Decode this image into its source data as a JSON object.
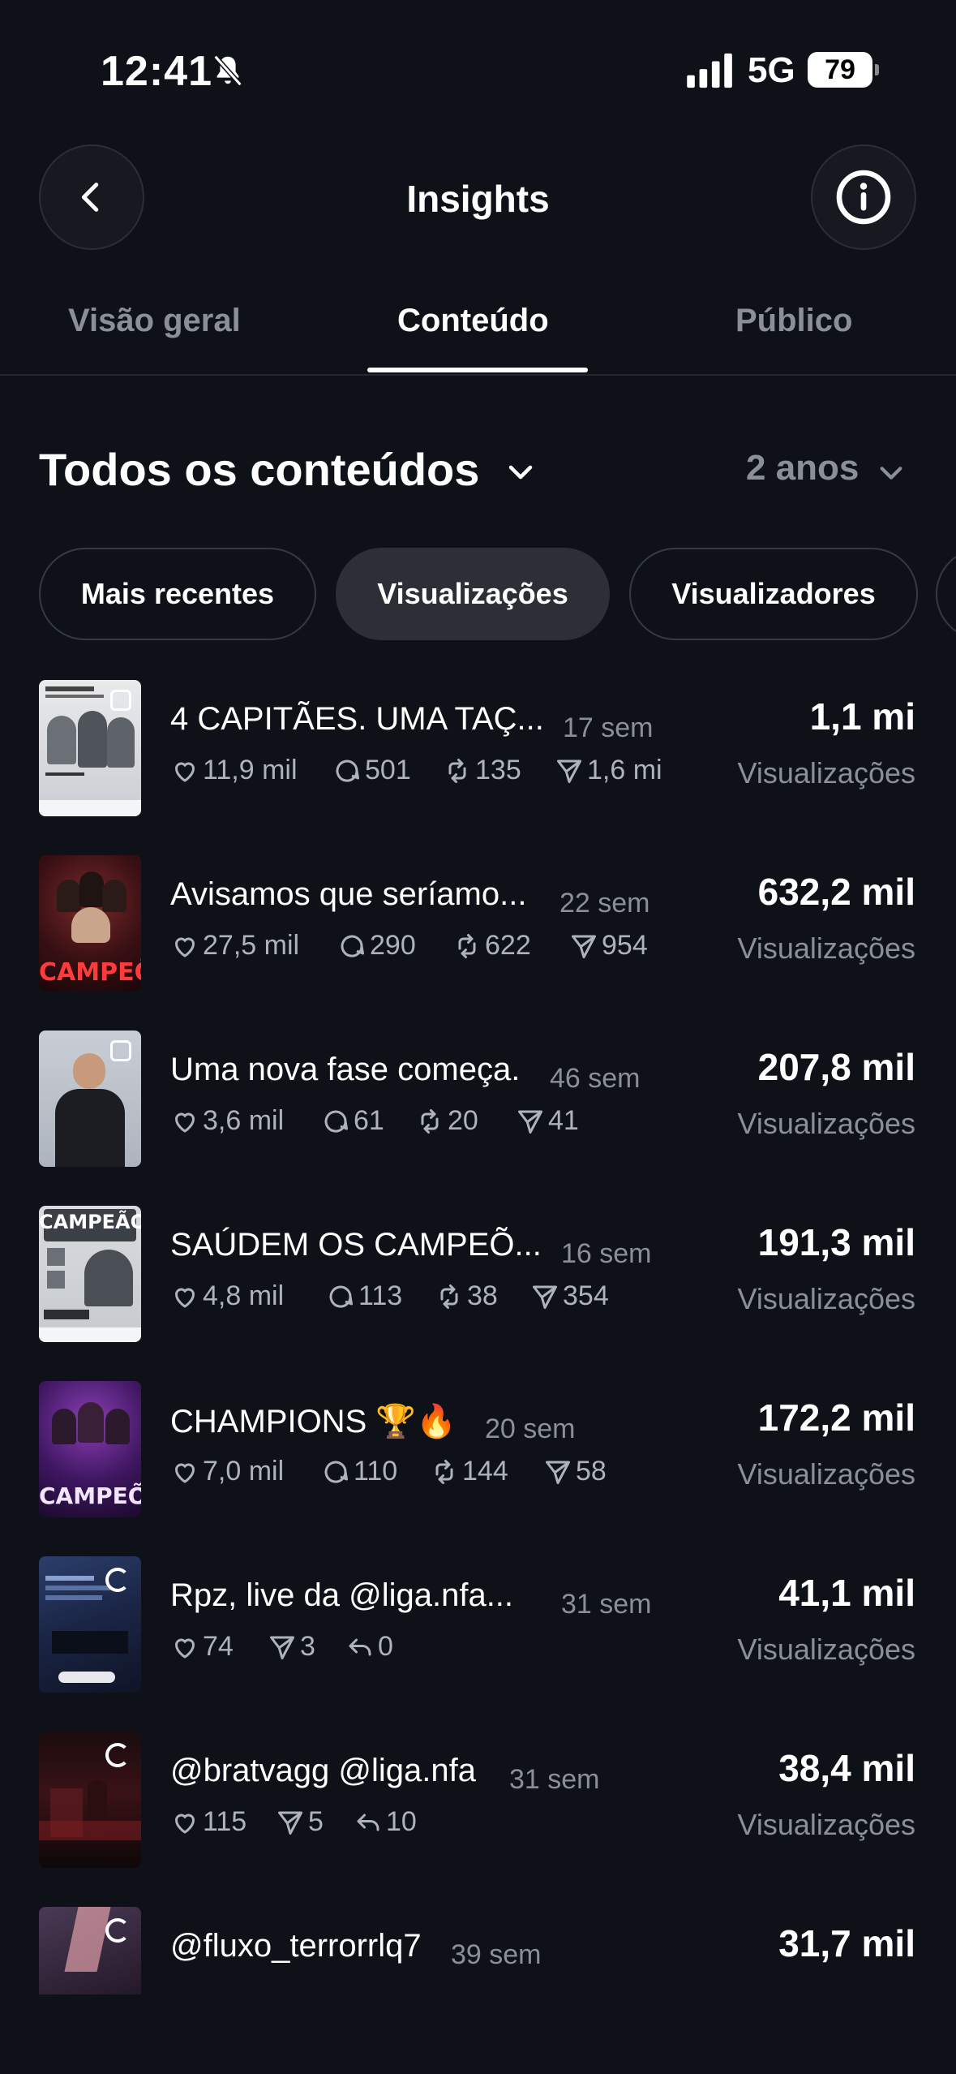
{
  "status": {
    "time": "12:41",
    "network": "5G",
    "battery": "79"
  },
  "header": {
    "title": "Insights"
  },
  "tabs": [
    {
      "label": "Visão geral"
    },
    {
      "label": "Conteúdo"
    },
    {
      "label": "Público"
    }
  ],
  "filter": {
    "title": "Todos os conteúdos",
    "range": "2 anos"
  },
  "chips": [
    {
      "label": "Mais recentes"
    },
    {
      "label": "Visualizações"
    },
    {
      "label": "Visualizadores"
    }
  ],
  "views_label": "Visualizações",
  "posts": [
    {
      "caption": "4 CAPITÃES. UMA TAÇ...",
      "age": "17 sem",
      "likes": "11,9 mil",
      "comments": "501",
      "reposts": "135",
      "shares": "1,6 mil",
      "views": "1,1 mi"
    },
    {
      "caption": "Avisamos que seríamo...",
      "age": "22 sem",
      "likes": "27,5 mil",
      "comments": "290",
      "reposts": "622",
      "shares": "954",
      "views": "632,2 mil"
    },
    {
      "caption": "Uma nova fase começa.",
      "age": "46 sem",
      "likes": "3,6 mil",
      "comments": "61",
      "reposts": "20",
      "shares": "41",
      "views": "207,8 mil"
    },
    {
      "caption": "SAÚDEM OS CAMPEÕ...",
      "age": "16 sem",
      "likes": "4,8 mil",
      "comments": "113",
      "reposts": "38",
      "shares": "354",
      "views": "191,3 mil"
    },
    {
      "caption": "CHAMPIONS 🏆🔥",
      "age": "20 sem",
      "likes": "7,0 mil",
      "comments": "110",
      "reposts": "144",
      "shares": "58",
      "views": "172,2 mil"
    },
    {
      "caption": "Rpz, live da @liga.nfa...",
      "age": "31 sem",
      "likes": "74",
      "shares": "3",
      "replies": "0",
      "views": "41,1 mil"
    },
    {
      "caption": "@bratvagg  @liga.nfa",
      "age": "31 sem",
      "likes": "115",
      "shares": "5",
      "replies": "10",
      "views": "38,4 mil"
    },
    {
      "caption": "@fluxo_terrorrlq7",
      "age": "39 sem",
      "views": "31,7 mil"
    }
  ],
  "thumb_text": {
    "post2": "CAMPEÕES",
    "post4": "CAMPEÃO",
    "post5": "CAMPEÕES"
  },
  "colors": {
    "background": "#0e1218",
    "muted": "#8b9097",
    "chip_active": "#2c3036"
  }
}
